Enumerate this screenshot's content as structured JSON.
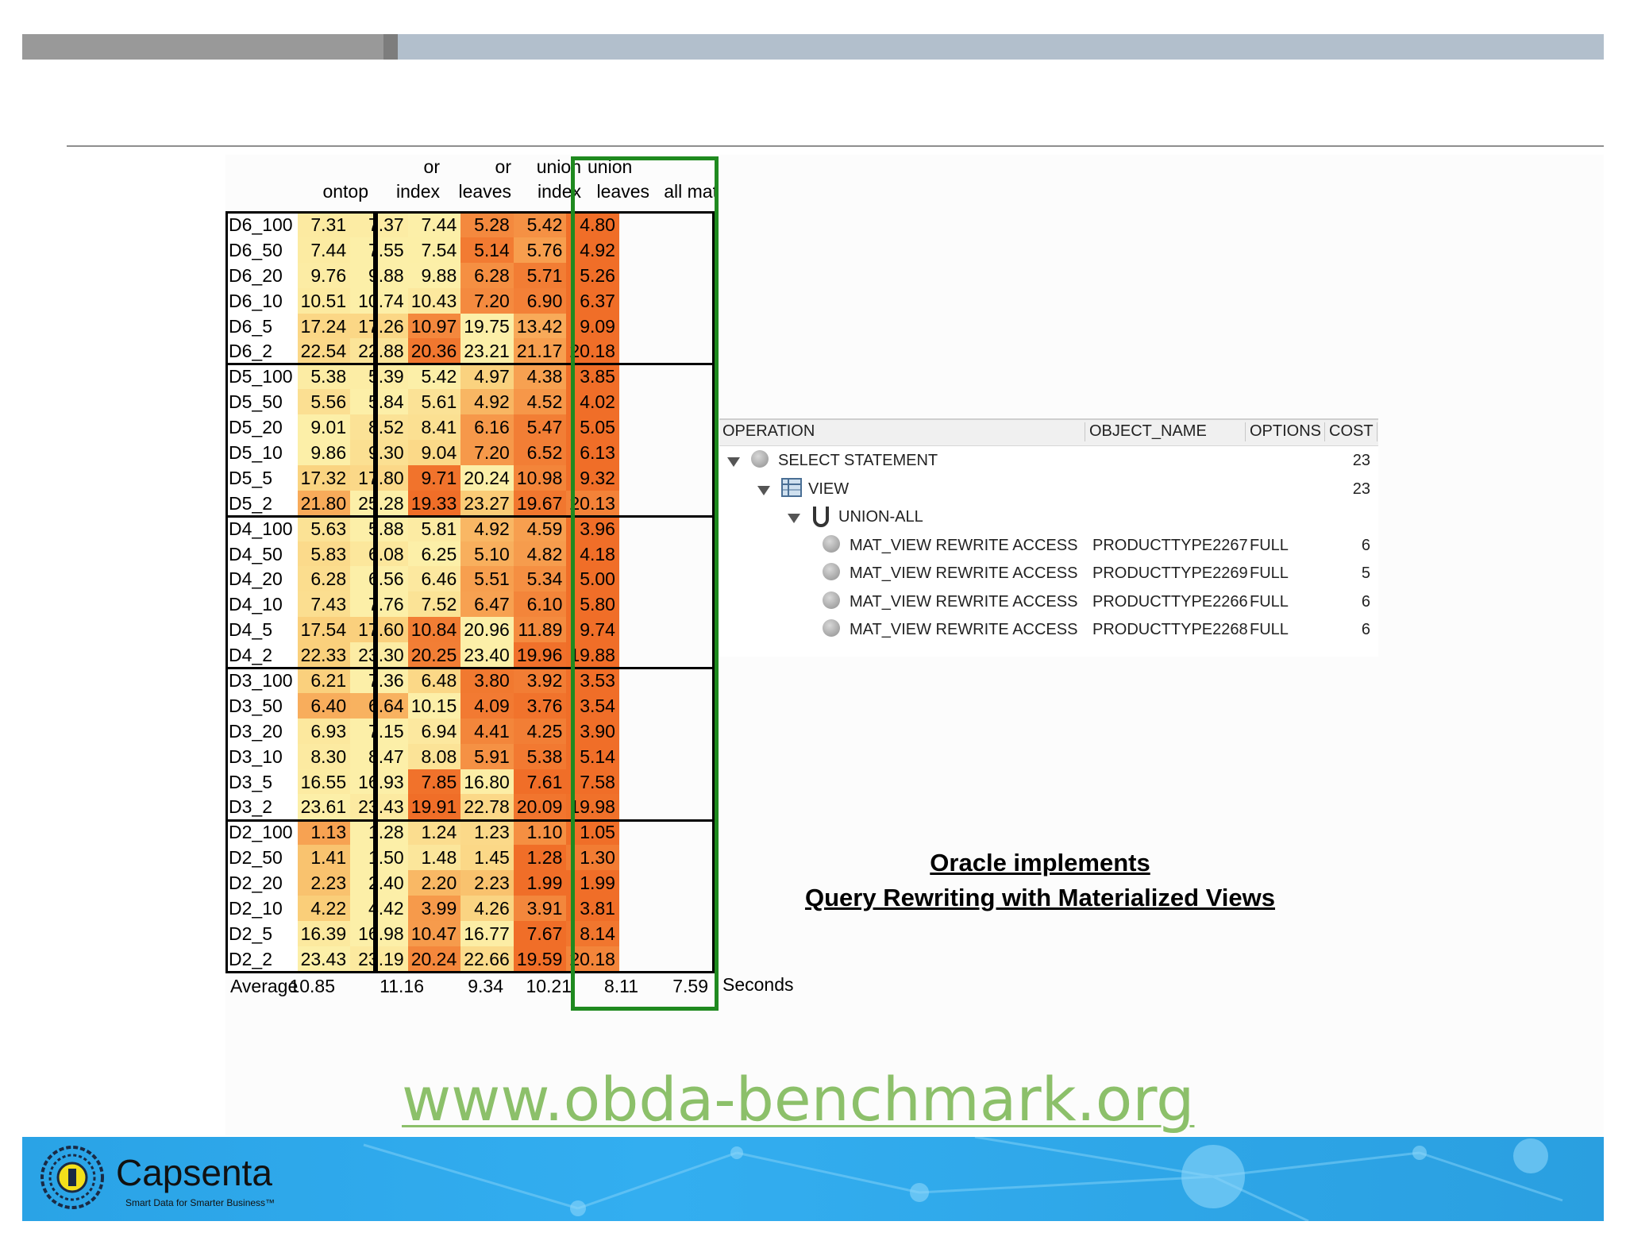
{
  "header_bar": {
    "colors": {
      "dark": "#999999",
      "light": "#b2bfcc"
    }
  },
  "table": {
    "columns": [
      {
        "line1": "",
        "line2": "ontop"
      },
      {
        "line1": "or",
        "line2": "index"
      },
      {
        "line1": "or",
        "line2": "leaves"
      },
      {
        "line1": "union",
        "line2": "index"
      },
      {
        "line1": "union",
        "line2": "leaves"
      },
      {
        "line1": "",
        "line2": "all mat"
      }
    ],
    "rows": [
      {
        "label": "D6_100",
        "values": [
          "7.31",
          "7.37",
          "7.44",
          "5.28",
          "5.42",
          "4.80"
        ]
      },
      {
        "label": "D6_50",
        "values": [
          "7.44",
          "7.55",
          "7.54",
          "5.14",
          "5.76",
          "4.92"
        ]
      },
      {
        "label": "D6_20",
        "values": [
          "9.76",
          "9.88",
          "9.88",
          "6.28",
          "5.71",
          "5.26"
        ]
      },
      {
        "label": "D6_10",
        "values": [
          "10.51",
          "10.74",
          "10.43",
          "7.20",
          "6.90",
          "6.37"
        ]
      },
      {
        "label": "D6_5",
        "values": [
          "17.24",
          "17.26",
          "10.97",
          "19.75",
          "13.42",
          "9.09"
        ]
      },
      {
        "label": "D6_2",
        "values": [
          "22.54",
          "22.88",
          "20.36",
          "23.21",
          "21.17",
          "20.18"
        ]
      },
      {
        "label": "D5_100",
        "values": [
          "5.38",
          "5.39",
          "5.42",
          "4.97",
          "4.38",
          "3.85"
        ]
      },
      {
        "label": "D5_50",
        "values": [
          "5.56",
          "5.84",
          "5.61",
          "4.92",
          "4.52",
          "4.02"
        ]
      },
      {
        "label": "D5_20",
        "values": [
          "9.01",
          "8.52",
          "8.41",
          "6.16",
          "5.47",
          "5.05"
        ]
      },
      {
        "label": "D5_10",
        "values": [
          "9.86",
          "9.30",
          "9.04",
          "7.20",
          "6.52",
          "6.13"
        ]
      },
      {
        "label": "D5_5",
        "values": [
          "17.32",
          "17.80",
          "9.71",
          "20.24",
          "10.98",
          "9.32"
        ]
      },
      {
        "label": "D5_2",
        "values": [
          "21.80",
          "25.28",
          "19.33",
          "23.27",
          "19.67",
          "20.13"
        ]
      },
      {
        "label": "D4_100",
        "values": [
          "5.63",
          "5.88",
          "5.81",
          "4.92",
          "4.59",
          "3.96"
        ]
      },
      {
        "label": "D4_50",
        "values": [
          "5.83",
          "6.08",
          "6.25",
          "5.10",
          "4.82",
          "4.18"
        ]
      },
      {
        "label": "D4_20",
        "values": [
          "6.28",
          "6.56",
          "6.46",
          "5.51",
          "5.34",
          "5.00"
        ]
      },
      {
        "label": "D4_10",
        "values": [
          "7.43",
          "7.76",
          "7.52",
          "6.47",
          "6.10",
          "5.80"
        ]
      },
      {
        "label": "D4_5",
        "values": [
          "17.54",
          "17.60",
          "10.84",
          "20.96",
          "11.89",
          "9.74"
        ]
      },
      {
        "label": "D4_2",
        "values": [
          "22.33",
          "23.30",
          "20.25",
          "23.40",
          "19.96",
          "19.88"
        ]
      },
      {
        "label": "D3_100",
        "values": [
          "6.21",
          "7.36",
          "6.48",
          "3.80",
          "3.92",
          "3.53"
        ]
      },
      {
        "label": "D3_50",
        "values": [
          "6.40",
          "6.64",
          "10.15",
          "4.09",
          "3.76",
          "3.54"
        ]
      },
      {
        "label": "D3_20",
        "values": [
          "6.93",
          "7.15",
          "6.94",
          "4.41",
          "4.25",
          "3.90"
        ]
      },
      {
        "label": "D3_10",
        "values": [
          "8.30",
          "8.47",
          "8.08",
          "5.91",
          "5.38",
          "5.14"
        ]
      },
      {
        "label": "D3_5",
        "values": [
          "16.55",
          "16.93",
          "7.85",
          "16.80",
          "7.61",
          "7.58"
        ]
      },
      {
        "label": "D3_2",
        "values": [
          "23.61",
          "23.43",
          "19.91",
          "22.78",
          "20.09",
          "19.98"
        ]
      },
      {
        "label": "D2_100",
        "values": [
          "1.13",
          "1.28",
          "1.24",
          "1.23",
          "1.10",
          "1.05"
        ]
      },
      {
        "label": "D2_50",
        "values": [
          "1.41",
          "1.50",
          "1.48",
          "1.45",
          "1.28",
          "1.30"
        ]
      },
      {
        "label": "D2_20",
        "values": [
          "2.23",
          "2.40",
          "2.20",
          "2.23",
          "1.99",
          "1.99"
        ]
      },
      {
        "label": "D2_10",
        "values": [
          "4.22",
          "4.42",
          "3.99",
          "4.26",
          "3.91",
          "3.81"
        ]
      },
      {
        "label": "D2_5",
        "values": [
          "16.39",
          "16.98",
          "10.47",
          "16.77",
          "7.67",
          "8.14"
        ]
      },
      {
        "label": "D2_2",
        "values": [
          "23.43",
          "23.19",
          "20.24",
          "22.66",
          "19.59",
          "20.18"
        ]
      }
    ],
    "average": {
      "label": "Average",
      "values": [
        "10.85",
        "11.16",
        "9.34",
        "10.21",
        "8.11",
        "7.59"
      ]
    },
    "unit": "Seconds",
    "colors": {
      "highlight": "#1f8a1f"
    }
  },
  "plan": {
    "headers": [
      "OPERATION",
      "OBJECT_NAME",
      "OPTIONS",
      "COST"
    ],
    "rows": [
      {
        "operation": "SELECT STATEMENT",
        "object": "",
        "options": "",
        "cost": "23",
        "icon": "circle-icon",
        "level": 0
      },
      {
        "operation": "VIEW",
        "object": "",
        "options": "",
        "cost": "23",
        "icon": "view-table-icon",
        "level": 1
      },
      {
        "operation": "UNION-ALL",
        "object": "",
        "options": "",
        "cost": "",
        "icon": "union-icon",
        "level": 2
      },
      {
        "operation": "MAT_VIEW REWRITE ACCESS",
        "object": "PRODUCTTYPE2267",
        "options": "FULL",
        "cost": "6",
        "icon": "circle-icon",
        "level": 3
      },
      {
        "operation": "MAT_VIEW REWRITE ACCESS",
        "object": "PRODUCTTYPE2269",
        "options": "FULL",
        "cost": "5",
        "icon": "circle-icon",
        "level": 3
      },
      {
        "operation": "MAT_VIEW REWRITE ACCESS",
        "object": "PRODUCTTYPE2266",
        "options": "FULL",
        "cost": "6",
        "icon": "circle-icon",
        "level": 3
      },
      {
        "operation": "MAT_VIEW REWRITE ACCESS",
        "object": "PRODUCTTYPE2268",
        "options": "FULL",
        "cost": "6",
        "icon": "circle-icon",
        "level": 3
      }
    ]
  },
  "caption": {
    "line1": "Oracle implements",
    "line2": "Query Rewriting with Materialized Views"
  },
  "url": "www.obda-benchmark.org",
  "footer": {
    "brand": "Capsenta",
    "tagline": "Smart Data for Smarter Business™",
    "colors": {
      "bg": "#2aa3e6",
      "url": "#8cc06a"
    }
  }
}
